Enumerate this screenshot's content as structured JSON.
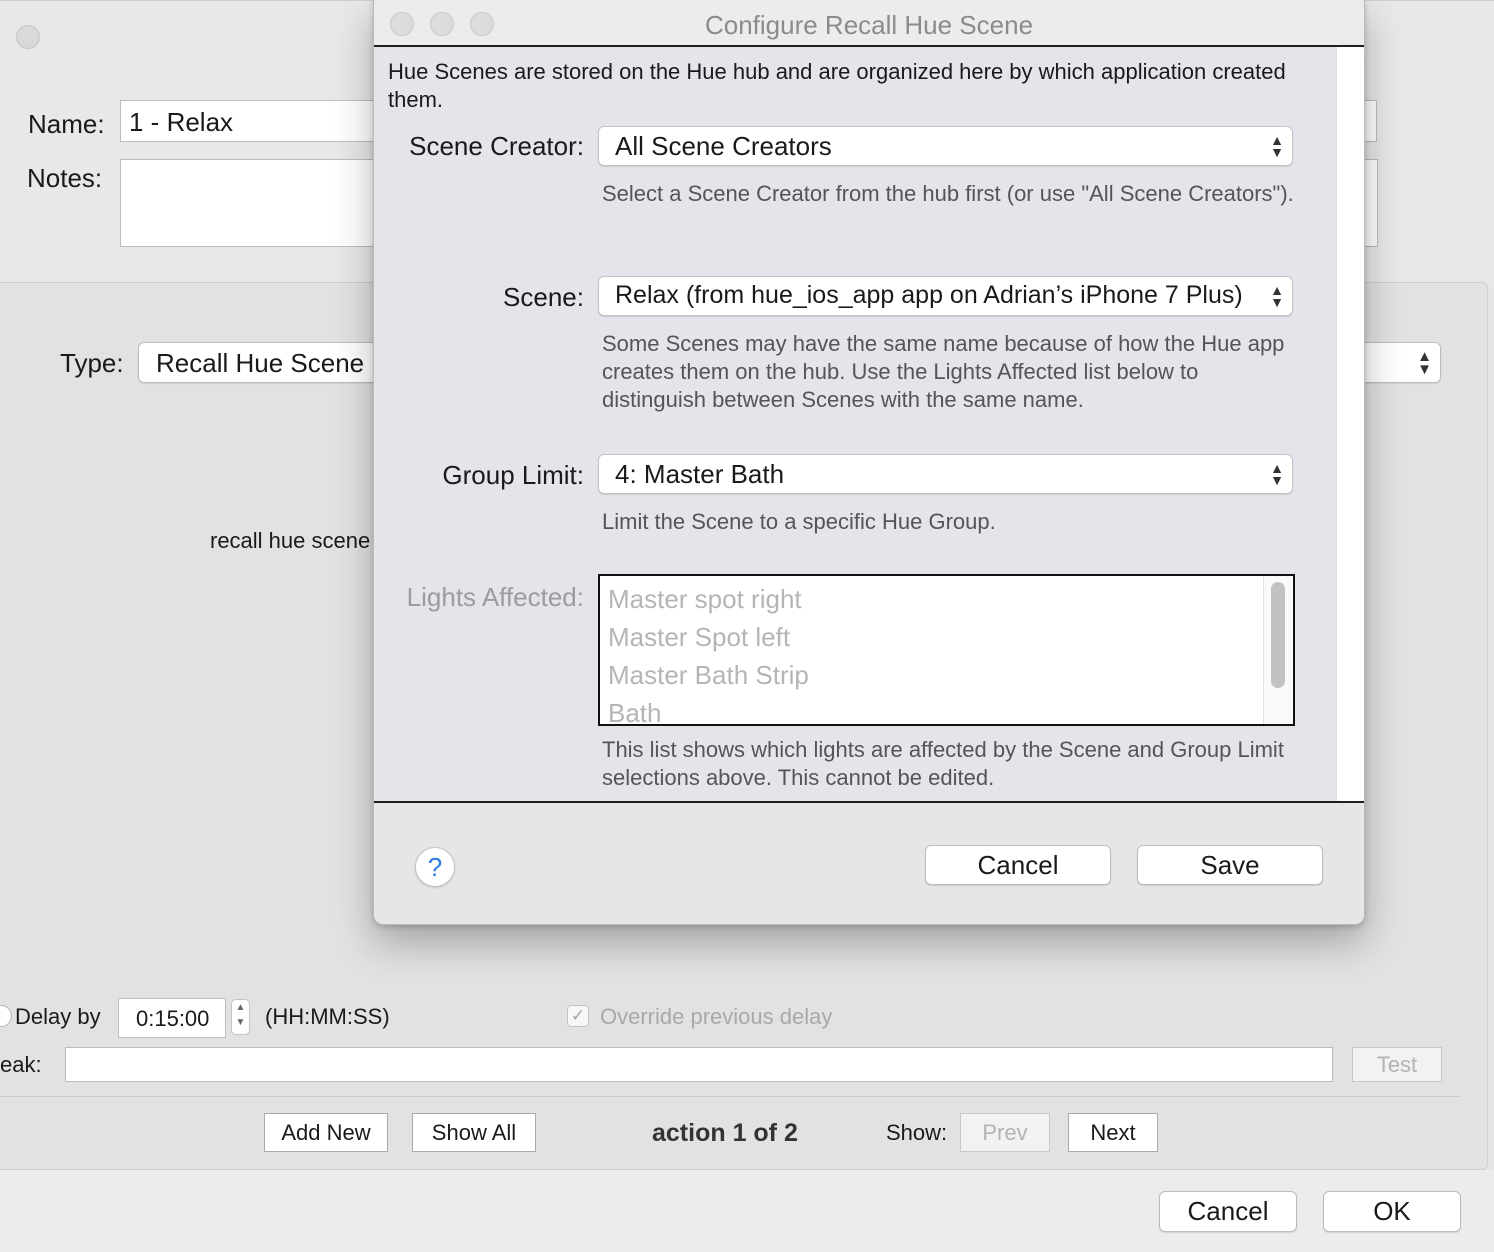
{
  "background_window": {
    "name_label": "Name:",
    "name_value": "1 - Relax",
    "notes_label": "Notes:",
    "notes_value": "",
    "type_label": "Type:",
    "type_value": "Recall Hue Scene",
    "action_summary": "recall hue scene",
    "delay_label": "Delay by",
    "delay_value": "0:15:00",
    "delay_format": "(HH:MM:SS)",
    "override_label": "Override previous delay",
    "override_checked": true,
    "speak_label": "eak:",
    "speak_value": "",
    "test_label": "Test",
    "add_new_label": "Add New",
    "show_all_label": "Show All",
    "action_counter": "action 1 of 2",
    "show_label": "Show:",
    "prev_label": "Prev",
    "next_label": "Next",
    "cancel_label": "Cancel",
    "ok_label": "OK"
  },
  "dialog": {
    "title": "Configure Recall Hue Scene",
    "intro": "Hue Scenes are stored on the Hue hub and are organized here by which application created them.",
    "scene_creator": {
      "label": "Scene Creator:",
      "value": "All Scene Creators",
      "help": "Select a Scene Creator from the hub first (or use \"All Scene Creators\")."
    },
    "scene": {
      "label": "Scene:",
      "value": "Relax (from hue_ios_app app on Adrian’s iPhone 7 Plus)",
      "help": "Some Scenes may have the same name because of how the Hue app creates them on the hub. Use the Lights Affected list below to distinguish between Scenes with the same name."
    },
    "group_limit": {
      "label": "Group Limit:",
      "value": "4: Master Bath",
      "help": "Limit the Scene to a specific Hue Group."
    },
    "lights_affected": {
      "label": "Lights Affected:",
      "items": [
        "Master spot right",
        "Master Spot left",
        "Master Bath Strip",
        "Bath"
      ],
      "help": "This list shows which lights are affected by the Scene and Group Limit selections above. This cannot be edited."
    },
    "help_button": "?",
    "cancel_label": "Cancel",
    "save_label": "Save"
  }
}
